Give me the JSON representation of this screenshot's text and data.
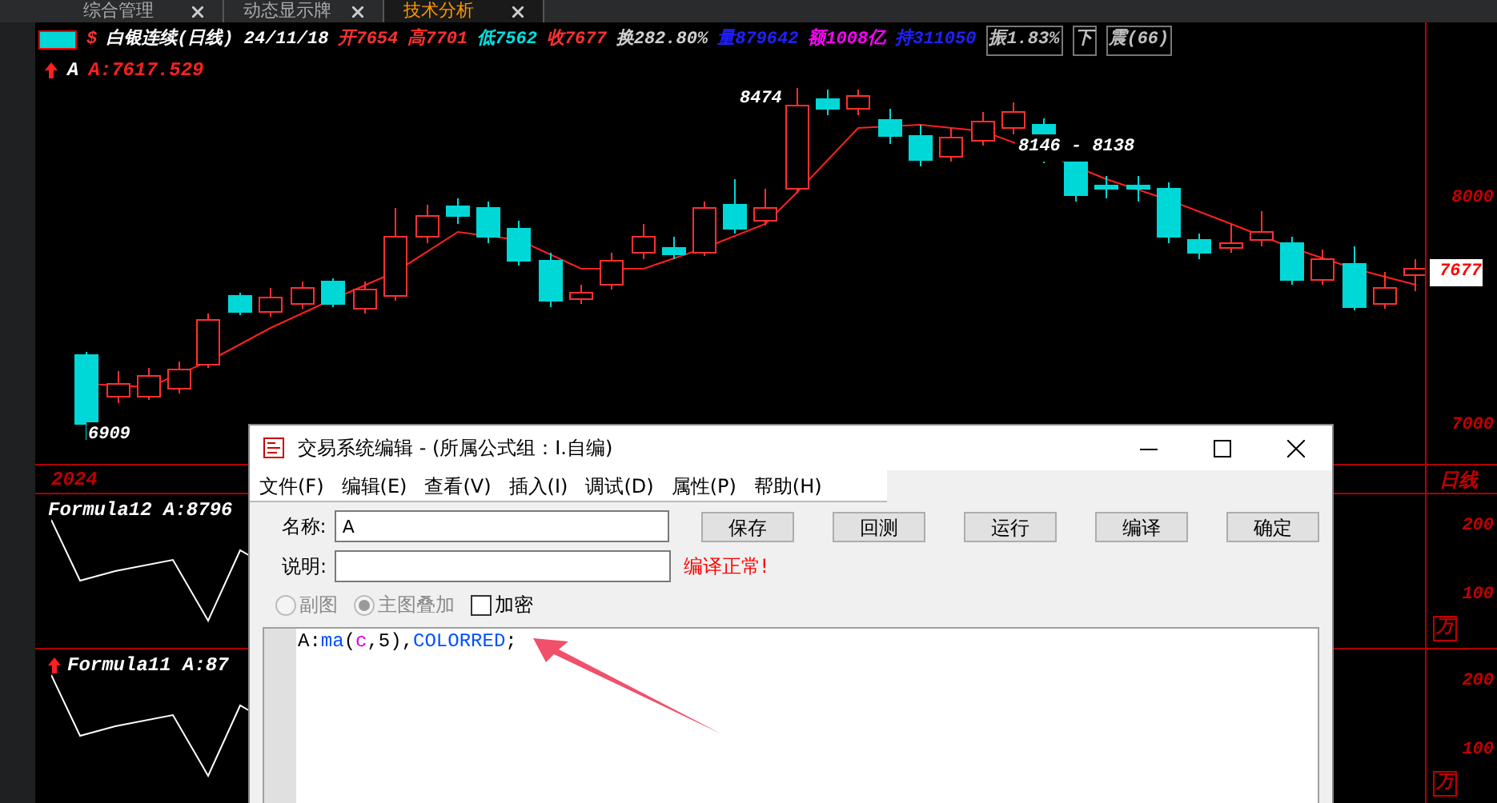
{
  "tabs": [
    {
      "label": "综合管理",
      "selected": false
    },
    {
      "label": "动态显示牌",
      "selected": false
    },
    {
      "label": "技术分析",
      "selected": true
    }
  ],
  "quote": {
    "symbol_mark": "$",
    "title": "白银连续(日线) 24/11/18",
    "fields": [
      {
        "text": "开7654",
        "color": "#ff3030"
      },
      {
        "text": "高7701",
        "color": "#ff3030"
      },
      {
        "text": "低7562",
        "color": "#00e0e0"
      },
      {
        "text": "收7677",
        "color": "#ff3030"
      },
      {
        "text": "换282.80%",
        "color": "#d0d0d0"
      },
      {
        "text": "量879642",
        "color": "#2020ff"
      },
      {
        "text": "额1008亿",
        "color": "#ff00ff"
      },
      {
        "text": "持311050",
        "color": "#2020ff"
      }
    ],
    "badges": [
      "振1.83%",
      "下",
      "震(66)"
    ]
  },
  "indicator": {
    "name": "A",
    "value": "A:7617.529"
  },
  "price_chart": {
    "high_label": "8474",
    "range_label": "8146 - 8138",
    "low_label": "6909",
    "axis": [
      "8000",
      "7000"
    ],
    "price_tag": "7677",
    "year": "2024",
    "period": "日线"
  },
  "panels": [
    {
      "title": "Formula12 A:8796",
      "has_arrow": false,
      "axis": [
        "200",
        "100"
      ],
      "unit": "万"
    },
    {
      "title": "Formula11 A:87",
      "has_arrow": true,
      "axis": [
        "200",
        "100"
      ],
      "unit": "万"
    }
  ],
  "dialog": {
    "title": "交易系统编辑 - (所属公式组：I.自编)",
    "menus": [
      "文件(F)",
      "编辑(E)",
      "查看(V)",
      "插入(I)",
      "调试(D)",
      "属性(P)",
      "帮助(H)"
    ],
    "name_label": "名称:",
    "name_value": "A",
    "desc_label": "说明:",
    "buttons": [
      "保存",
      "回测",
      "运行",
      "编译",
      "确定"
    ],
    "status": "编译正常!",
    "options": [
      {
        "kind": "radio",
        "label": "副图",
        "selected": false,
        "disabled": true
      },
      {
        "kind": "radio",
        "label": "主图叠加",
        "selected": true,
        "disabled": true
      },
      {
        "kind": "checkbox",
        "label": "加密",
        "checked": false
      }
    ],
    "code": [
      {
        "kind": "plain",
        "text": "A:"
      },
      {
        "kind": "function",
        "text": "ma"
      },
      {
        "kind": "plain",
        "text": "("
      },
      {
        "kind": "variable",
        "text": "c"
      },
      {
        "kind": "plain",
        "text": ",5),"
      },
      {
        "kind": "constant",
        "text": "COLORRED"
      },
      {
        "kind": "plain",
        "text": ";"
      }
    ]
  }
}
